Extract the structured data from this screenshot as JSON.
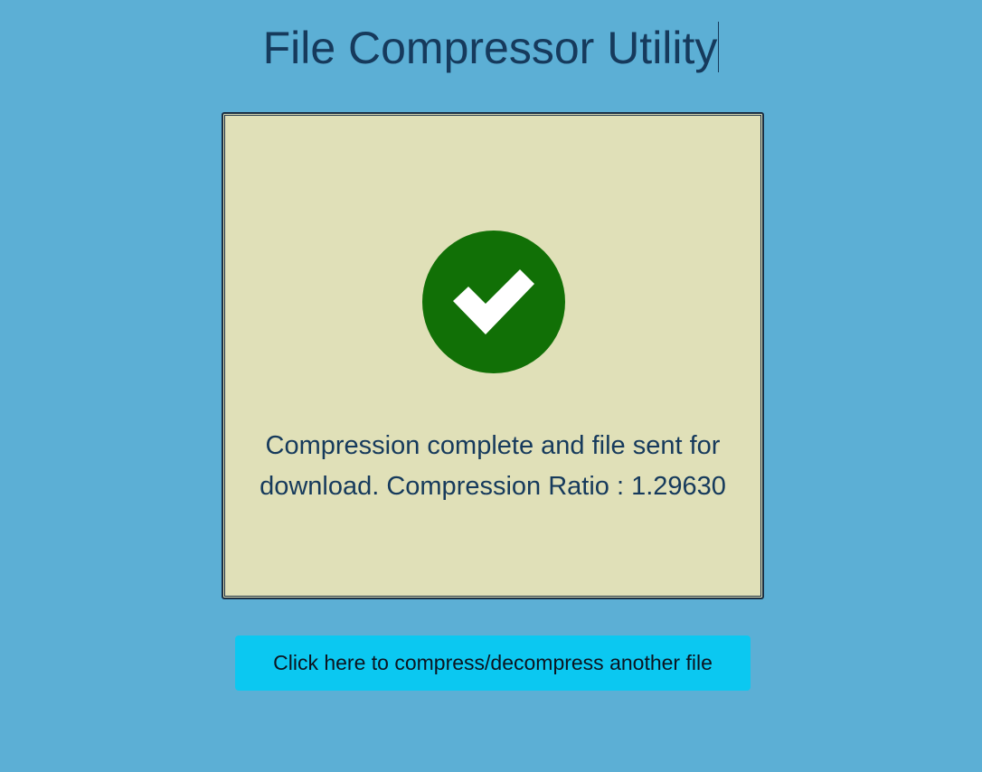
{
  "header": {
    "title": "File Compressor Utility"
  },
  "result": {
    "status_icon": "check-circle-icon",
    "message": "Compression complete and file sent for download. Compression Ratio : 1.29630"
  },
  "actions": {
    "restart_label": "Click here to compress/decompress another file"
  },
  "colors": {
    "background": "#5cafd5",
    "panel": "#e0e0b8",
    "panel_border": "#1b2f44",
    "text": "#163a5c",
    "success": "#117006",
    "button": "#0bc8f1"
  }
}
